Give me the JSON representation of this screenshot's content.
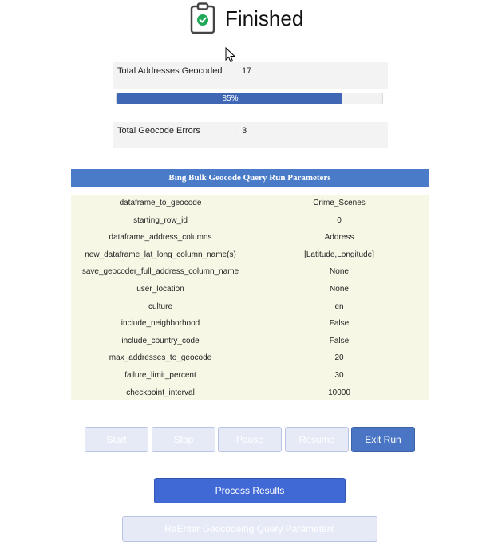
{
  "header": {
    "title": "Finished",
    "status_icon": "clipboard-check-icon",
    "check_color": "#21a95a"
  },
  "stats": {
    "total_geocoded_label": "Total Addresses Geocoded",
    "total_geocoded_value": "17",
    "progress_percent": 85,
    "progress_text": "85%",
    "total_errors_label": "Total Geocode Errors",
    "total_errors_value": "3",
    "separator": ":"
  },
  "params": {
    "title": "Bing Bulk Geocode Query Run Parameters",
    "rows": [
      {
        "key": "dataframe_to_geocode",
        "value": "Crime_Scenes"
      },
      {
        "key": "starting_row_id",
        "value": "0"
      },
      {
        "key": "dataframe_address_columns",
        "value": "Address"
      },
      {
        "key": "new_dataframe_lat_long_column_name(s)",
        "value": "[Latitude,Longitude]"
      },
      {
        "key": "save_geocoder_full_address_column_name",
        "value": "None"
      },
      {
        "key": "user_location",
        "value": "None"
      },
      {
        "key": "culture",
        "value": "en"
      },
      {
        "key": "include_neighborhood",
        "value": "False"
      },
      {
        "key": "include_country_code",
        "value": "False"
      },
      {
        "key": "max_addresses_to_geocode",
        "value": "20"
      },
      {
        "key": "failure_limit_percent",
        "value": "30"
      },
      {
        "key": "checkpoint_interval",
        "value": "10000"
      }
    ]
  },
  "buttons": {
    "start": "Start",
    "stop": "Stop",
    "pause": "Pause",
    "resume": "Resume",
    "exit_run": "Exit Run",
    "process_results": "Process Results",
    "reenter": "ReEnter Geocodeing Query Parameters"
  },
  "colors": {
    "accent": "#4a75c4",
    "params_header": "#4a7bc8",
    "params_bg": "#f7f7e6"
  }
}
